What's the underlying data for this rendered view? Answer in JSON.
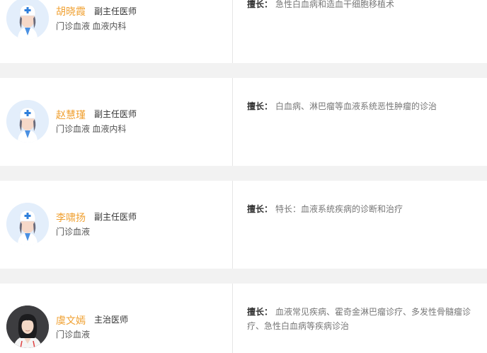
{
  "specialty_label": "擅长：",
  "doctors": [
    {
      "name": "胡晓霞",
      "title": "副主任医师",
      "dept": "门诊血液 血液内科",
      "specialty": "急性白血病和造血干细胞移植术",
      "avatar": "doctor-placeholder-icon"
    },
    {
      "name": "赵慧瑾",
      "title": "副主任医师",
      "dept": "门诊血液 血液内科",
      "specialty": "白血病、淋巴瘤等血液系统恶性肿瘤的诊治",
      "avatar": "doctor-placeholder-icon"
    },
    {
      "name": "李啸扬",
      "title": "副主任医师",
      "dept": "门诊血液",
      "specialty": "特长：血液系统疾病的诊断和治疗",
      "avatar": "doctor-placeholder-icon"
    },
    {
      "name": "虞文嫣",
      "title": "主治医师",
      "dept": "门诊血液",
      "specialty": "血液常见疾病、霍奇金淋巴瘤诊疗、多发性骨髓瘤诊疗、急性白血病等疾病诊治",
      "avatar": "doctor-photo"
    }
  ]
}
